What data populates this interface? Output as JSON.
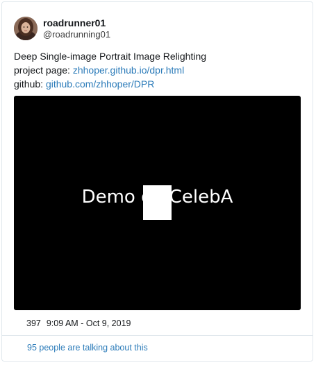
{
  "user": {
    "display_name": "roadrunner01",
    "handle": "@roadrunning01",
    "avatar_icon": "user-avatar-photo"
  },
  "tweet": {
    "line1": "Deep Single-image Portrait Image Relighting",
    "project_label": "project page: ",
    "project_link": "zhhoper.github.io/dpr.html",
    "github_label": "github: ",
    "github_link": "github.com/zhhoper/DPR"
  },
  "media": {
    "video_title": "Demo on CelebA"
  },
  "meta": {
    "likes": "397",
    "time": "9:09 AM",
    "separator": " - ",
    "date": "Oct 9, 2019"
  },
  "footer": {
    "talking": "95 people are talking about this"
  },
  "colors": {
    "link": "#2b7bb9",
    "border": "#e1e8ed",
    "media_bg": "#000000"
  }
}
